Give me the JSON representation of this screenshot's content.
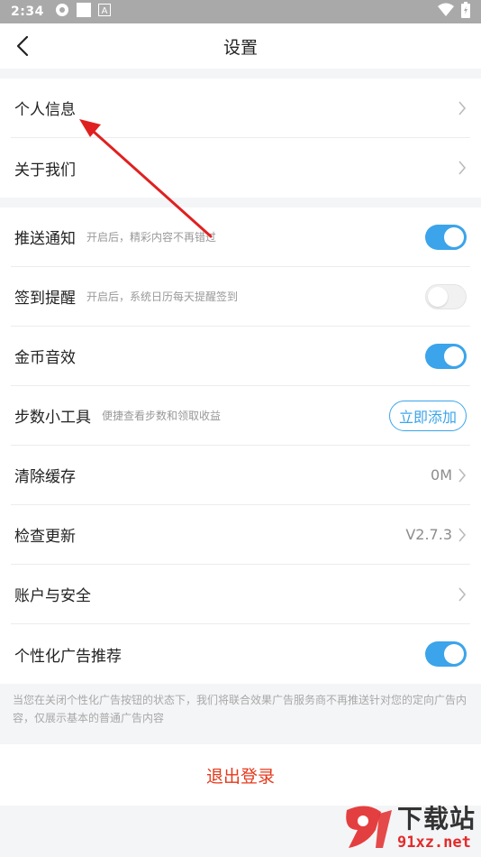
{
  "status_bar": {
    "time": "2:34"
  },
  "header": {
    "title": "设置"
  },
  "group1": [
    {
      "label": "个人信息"
    },
    {
      "label": "关于我们"
    }
  ],
  "group2": {
    "push": {
      "label": "推送通知",
      "sub": "开启后，精彩内容不再错过",
      "toggle": true
    },
    "checkin": {
      "label": "签到提醒",
      "sub": "开启后，系统日历每天提醒签到",
      "toggle": false
    },
    "coin_sound": {
      "label": "金币音效",
      "toggle": true
    },
    "steps": {
      "label": "步数小工具",
      "sub": "便捷查看步数和领取收益",
      "button": "立即添加"
    },
    "cache": {
      "label": "清除缓存",
      "value": "0M"
    },
    "update": {
      "label": "检查更新",
      "value": "V2.7.3"
    },
    "account": {
      "label": "账户与安全"
    },
    "ads": {
      "label": "个性化广告推荐",
      "toggle": true
    }
  },
  "notice": "当您在关闭个性化广告按钮的状态下，我们将联合效果广告服务商不再推送针对您的定向广告内容，仅展示基本的普通广告内容",
  "logout": "退出登录",
  "watermark": {
    "cn": "下载站",
    "url": "91xz.net"
  },
  "colors": {
    "accent": "#3ba4ea",
    "logout": "#e5391c",
    "arrow": "#e02020"
  }
}
